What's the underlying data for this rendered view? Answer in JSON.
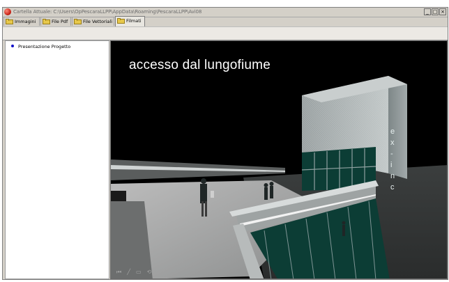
{
  "window": {
    "title": "Cartella Attuale: C:\\Users\\OpPescaraLLPP\\AppData\\Roaming\\PescaraLLPP\\Avi08",
    "controls": {
      "minimize": "_",
      "maximize": "□",
      "close": "×"
    }
  },
  "tabs": [
    {
      "label": "Immagini",
      "icon": "folder-icon",
      "active": false
    },
    {
      "label": "File Pdf",
      "icon": "folder-icon",
      "active": false
    },
    {
      "label": "File Vettoriali",
      "icon": "folder-icon",
      "active": false
    },
    {
      "label": "Filmati",
      "icon": "folder-icon",
      "active": true
    }
  ],
  "sidebar": {
    "items": [
      {
        "label": "Presentazione Progetto",
        "bullet_color": "#1010c8"
      }
    ]
  },
  "viewer": {
    "scene_caption": "accesso dal lungofiume",
    "sign_letters": [
      "e",
      "x",
      "-",
      "i",
      "n",
      "c"
    ],
    "controls": [
      "⏮",
      "╱",
      "▭",
      "⟲"
    ]
  },
  "colors": {
    "window_bg": "#d4d0c8",
    "viewer_bg": "#000000",
    "accent_bullet": "#1010c8"
  }
}
